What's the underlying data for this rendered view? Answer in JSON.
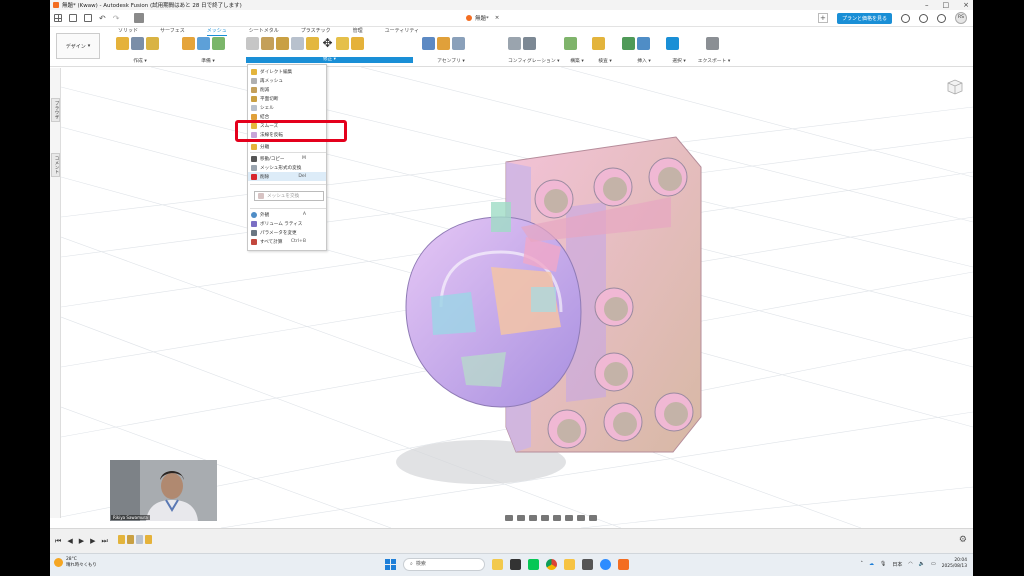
{
  "window": {
    "title": "無題* (Kwaw) - Autodesk Fusion (試用期間はあと 28 日で終了します)",
    "doc_tab": "無題*"
  },
  "topbar": {
    "upgrade_label": "プランと価格を見る",
    "avatar_initials": "RS",
    "plus_label": "+"
  },
  "ribbon": {
    "workspace_label": "デザイン",
    "tabs": [
      {
        "label": "ソリッド",
        "active": false
      },
      {
        "label": "サーフェス",
        "active": false
      },
      {
        "label": "メッシュ",
        "active": true
      },
      {
        "label": "シートメタル",
        "active": false
      },
      {
        "label": "プラスチック",
        "active": false
      },
      {
        "label": "管理",
        "active": false
      },
      {
        "label": "ユーティリティ",
        "active": false
      }
    ],
    "groups": {
      "create": "作成 ▾",
      "prepare": "準備 ▾",
      "modify": "修正 ▾",
      "assemble": "アセンブリ ▾",
      "configure": "コンフィグレーション ▾",
      "construct": "構築 ▾",
      "inspect": "検査 ▾",
      "insert": "挿入 ▾",
      "select": "選択 ▾",
      "export": "エクスポート ▾"
    }
  },
  "left_panel": {
    "browser_tab": "ブラウザ",
    "comment_tab": "コメント"
  },
  "modify_menu": {
    "items": [
      {
        "label": "ダイレクト編集",
        "shortcut": ""
      },
      {
        "label": "再メッシュ",
        "shortcut": ""
      },
      {
        "label": "削減",
        "shortcut": ""
      },
      {
        "label": "平面切断",
        "shortcut": ""
      },
      {
        "label": "シェル",
        "shortcut": ""
      },
      {
        "label": "結合",
        "shortcut": ""
      },
      {
        "label": "スムーズ",
        "shortcut": ""
      },
      {
        "label": "法線を反転",
        "shortcut": ""
      },
      {
        "label": "分離",
        "shortcut": ""
      },
      {
        "label": "移動/コピー",
        "shortcut": "M"
      },
      {
        "label": "メッシュ形式の変換",
        "shortcut": ""
      },
      {
        "label": "削除",
        "shortcut": "Del"
      },
      {
        "label": "メッシュを交換",
        "shortcut": ""
      },
      {
        "label": "外観",
        "shortcut": "A"
      },
      {
        "label": "ボリューム ラティス",
        "shortcut": ""
      },
      {
        "label": "パラメータを変更",
        "shortcut": ""
      },
      {
        "label": "すべて計算",
        "shortcut": "Ctrl+B"
      }
    ]
  },
  "webcam": {
    "name": "Rikiya Sawamura"
  },
  "taskbar": {
    "temperature": "28°C",
    "weather": "晴れ時々くもり",
    "search_placeholder": "検索",
    "ime": "日本",
    "time": "20:04",
    "date": "2025/08/13"
  },
  "colors": {
    "accent": "#1a8fd6",
    "highlight_box": "#e4001c",
    "menu_hover": "#ddecf8"
  }
}
